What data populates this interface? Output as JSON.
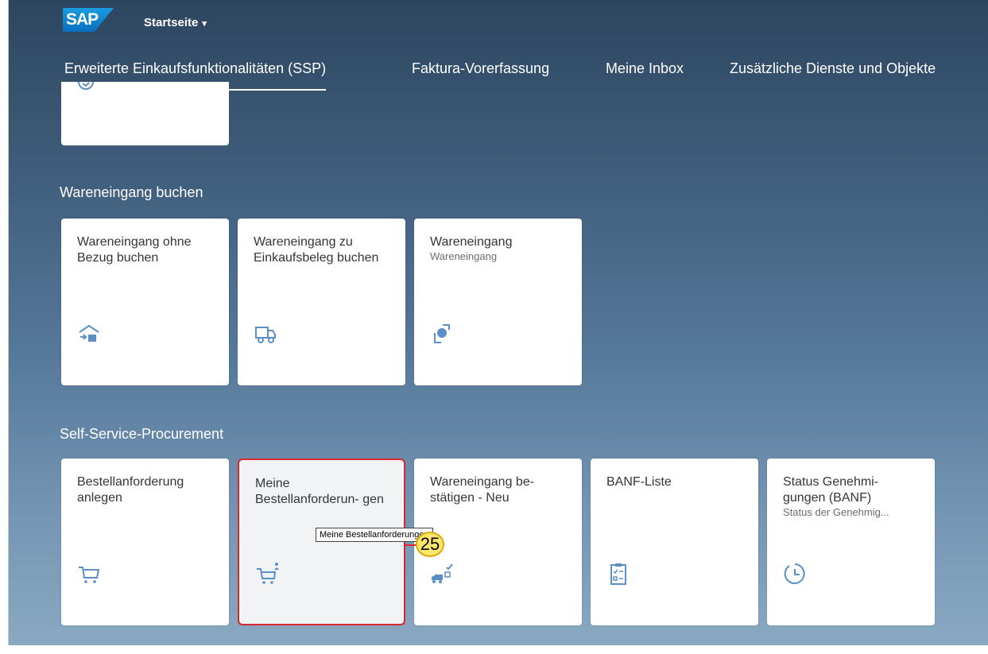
{
  "header": {
    "logo": "SAP",
    "home_title": "Startseite",
    "home_caret": "▾"
  },
  "tabs": [
    {
      "label": "Erweiterte Einkaufsfunktionalitäten (SSP)",
      "active": true
    },
    {
      "label": "Faktura-Vorerfassung"
    },
    {
      "label": "Meine Inbox"
    },
    {
      "label": "Zusätzliche Dienste und Objekte"
    }
  ],
  "groups": [
    {
      "title": "Wareneingang buchen",
      "tiles": [
        {
          "title": "Wareneingang ohne Bezug buchen",
          "subtitle": "",
          "icon": "warehouse-inbound-icon"
        },
        {
          "title": "Wareneingang zu Einkaufsbeleg buchen",
          "subtitle": "",
          "icon": "delivery-truck-icon"
        },
        {
          "title": "Wareneingang",
          "subtitle": "Wareneingang",
          "icon": "goods-receipt-icon"
        }
      ]
    },
    {
      "title": "Self-Service-Procurement",
      "tiles": [
        {
          "title": "Bestellanforderung anlegen",
          "subtitle": "",
          "icon": "cart-icon"
        },
        {
          "title": "Meine Bestellanforderun- gen",
          "subtitle": "",
          "icon": "cart-person-icon",
          "highlighted": true
        },
        {
          "title": "Wareneingang be- stätigen - Neu",
          "subtitle": "",
          "icon": "truck-check-icon"
        },
        {
          "title": "BANF-Liste",
          "subtitle": "",
          "icon": "clipboard-list-icon"
        },
        {
          "title": "Status Genehmi- gungen (BANF)",
          "subtitle": "Status der Genehmig...",
          "icon": "pending-clock-icon"
        }
      ]
    }
  ],
  "tooltip": "Meine Bestellanforderungen",
  "step_badge": "25",
  "colors": {
    "accent": "#5b8fc8",
    "highlight_border": "#d9282f",
    "badge": "#ffe66d"
  }
}
